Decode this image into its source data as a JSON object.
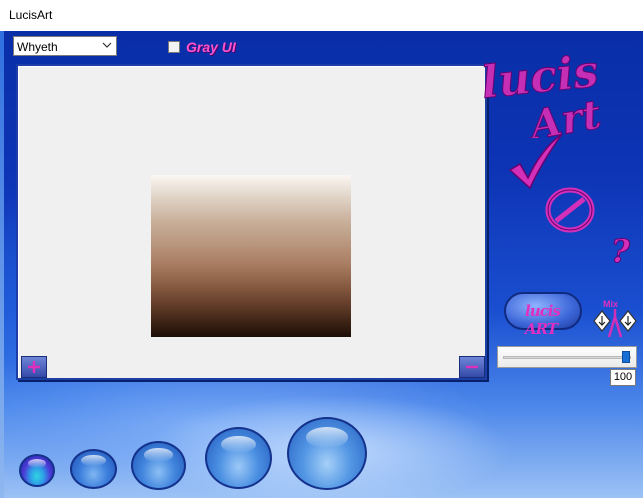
{
  "window": {
    "title": "LucisArt"
  },
  "toolbar": {
    "style_select": {
      "value": "Whyeth"
    },
    "gray_ui": {
      "label": "Gray UI",
      "checked": false
    }
  },
  "preview": {
    "zoom_in_icon": "plus-icon",
    "zoom_out_icon": "minus-icon"
  },
  "logo": {
    "text_top": "lucis",
    "text_bottom": "Art"
  },
  "side_buttons": {
    "ok_icon": "checkmark-icon",
    "cancel_icon": "cancel-icon",
    "help_icon": "question-mark-icon",
    "lucis_button_label": "lucis ART"
  },
  "mix": {
    "label": "Mix",
    "value": "100",
    "level": 1.0
  },
  "colors": {
    "accent": "#e02fbf",
    "background_dark": "#0a2ea8",
    "background_light": "#9cc2f5",
    "slider_thumb": "#1a6fd6"
  },
  "presets": [
    {
      "name": "preset-1",
      "icon": "orb-icon",
      "selected": true
    },
    {
      "name": "preset-2",
      "icon": "orb-icon",
      "selected": false
    },
    {
      "name": "preset-3",
      "icon": "orb-icon",
      "selected": false
    },
    {
      "name": "preset-4",
      "icon": "orb-icon",
      "selected": false
    },
    {
      "name": "preset-5",
      "icon": "orb-icon",
      "selected": false
    }
  ]
}
